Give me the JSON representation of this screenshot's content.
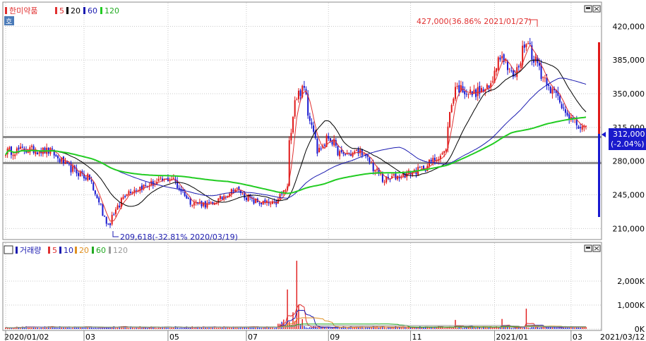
{
  "price_panel": {
    "stock_name": "한미약품",
    "tag": "호",
    "ma_labels": [
      "5",
      "20",
      "60",
      "120"
    ],
    "ma_colors": [
      "#e03030",
      "#000000",
      "#1a1ab0",
      "#22cc22"
    ],
    "current_price": "312,000",
    "current_change": "(-2.04%)",
    "high_annotation": "427,000(36.86% 2021/01/27)",
    "low_annotation": "209,618(-32.81% 2020/03/19)"
  },
  "volume_panel": {
    "title": "거래량",
    "ma_labels": [
      "5",
      "10",
      "20",
      "60",
      "120"
    ],
    "ma_colors": [
      "#e03030",
      "#1a1ab0",
      "#e09020",
      "#22aa22",
      "#999999"
    ]
  },
  "chart_data": {
    "type": "candlestick",
    "x_ticks": [
      "2020/01/02",
      "03",
      "05",
      "07",
      "09",
      "11",
      "2021/01",
      "03",
      "2021/03/12"
    ],
    "price_axis": {
      "ticks": [
        "420,000",
        "385,000",
        "350,000",
        "315,000",
        "280,000",
        "245,000",
        "210,000"
      ],
      "range": [
        200000,
        440000
      ]
    },
    "volume_axis": {
      "ticks": [
        "2,000K",
        "1,000K",
        "0K"
      ],
      "range": [
        0,
        3000
      ]
    },
    "horizontal_lines": [
      305000,
      278000
    ],
    "price_keyframes": [
      {
        "date": "2020-01-02",
        "close": 290000
      },
      {
        "date": "2020-01-20",
        "close": 292000
      },
      {
        "date": "2020-02-05",
        "close": 290000
      },
      {
        "date": "2020-02-20",
        "close": 272000
      },
      {
        "date": "2020-03-05",
        "close": 262000
      },
      {
        "date": "2020-03-19",
        "close": 214000
      },
      {
        "date": "2020-04-02",
        "close": 248000
      },
      {
        "date": "2020-04-20",
        "close": 256000
      },
      {
        "date": "2020-05-06",
        "close": 262000
      },
      {
        "date": "2020-05-20",
        "close": 238000
      },
      {
        "date": "2020-06-05",
        "close": 234000
      },
      {
        "date": "2020-06-22",
        "close": 252000
      },
      {
        "date": "2020-07-06",
        "close": 238000
      },
      {
        "date": "2020-07-22",
        "close": 235000
      },
      {
        "date": "2020-07-31",
        "close": 252000
      },
      {
        "date": "2020-08-06",
        "close": 345000
      },
      {
        "date": "2020-08-13",
        "close": 355000
      },
      {
        "date": "2020-08-24",
        "close": 290000
      },
      {
        "date": "2020-09-01",
        "close": 305000
      },
      {
        "date": "2020-09-10",
        "close": 286000
      },
      {
        "date": "2020-09-25",
        "close": 290000
      },
      {
        "date": "2020-10-12",
        "close": 260000
      },
      {
        "date": "2020-10-27",
        "close": 266000
      },
      {
        "date": "2020-11-10",
        "close": 272000
      },
      {
        "date": "2020-11-27",
        "close": 290000
      },
      {
        "date": "2020-12-04",
        "close": 358000
      },
      {
        "date": "2020-12-17",
        "close": 350000
      },
      {
        "date": "2020-12-30",
        "close": 355000
      },
      {
        "date": "2021-01-08",
        "close": 395000
      },
      {
        "date": "2021-01-18",
        "close": 365000
      },
      {
        "date": "2021-01-27",
        "close": 405000
      },
      {
        "date": "2021-02-08",
        "close": 370000
      },
      {
        "date": "2021-02-22",
        "close": 340000
      },
      {
        "date": "2021-03-05",
        "close": 318000
      },
      {
        "date": "2021-03-12",
        "close": 312000
      }
    ],
    "volume_spikes": [
      {
        "date": "2020-07-31",
        "volume": 1650
      },
      {
        "date": "2020-08-05",
        "volume": 700
      },
      {
        "date": "2020-08-07",
        "volume": 2850
      },
      {
        "date": "2020-08-10",
        "volume": 1000
      },
      {
        "date": "2020-12-04",
        "volume": 380
      },
      {
        "date": "2021-01-08",
        "volume": 420
      },
      {
        "date": "2021-01-27",
        "volume": 850
      }
    ]
  }
}
